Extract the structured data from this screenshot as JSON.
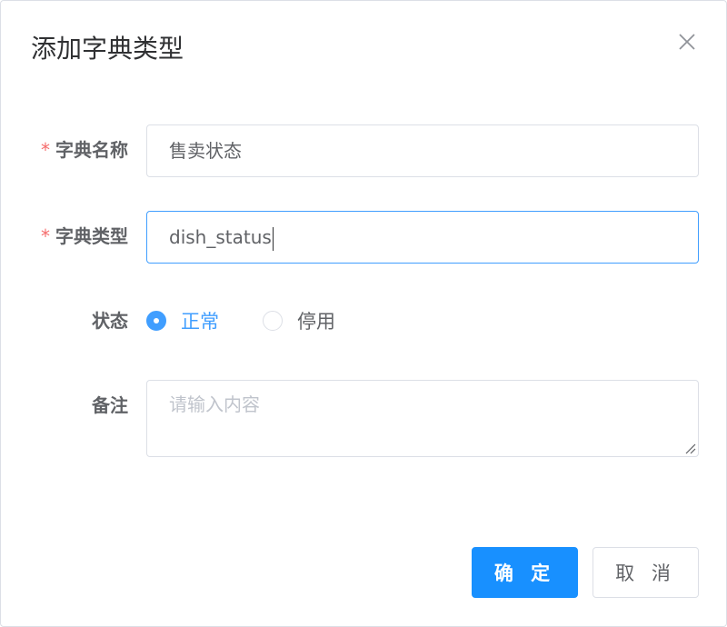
{
  "dialog": {
    "title": "添加字典类型",
    "close_icon": "close-icon"
  },
  "form": {
    "dict_name": {
      "label": "字典名称",
      "required": true,
      "value": "售卖状态"
    },
    "dict_type": {
      "label": "字典类型",
      "required": true,
      "value": "dish_status"
    },
    "status": {
      "label": "状态",
      "options": [
        "正常",
        "停用"
      ],
      "selected": "正常"
    },
    "remark": {
      "label": "备注",
      "placeholder": "请输入内容",
      "value": ""
    }
  },
  "footer": {
    "confirm_label": "确 定",
    "cancel_label": "取 消"
  },
  "colors": {
    "primary": "#1890ff",
    "required": "#f56c6c",
    "border": "#dcdfe6"
  }
}
